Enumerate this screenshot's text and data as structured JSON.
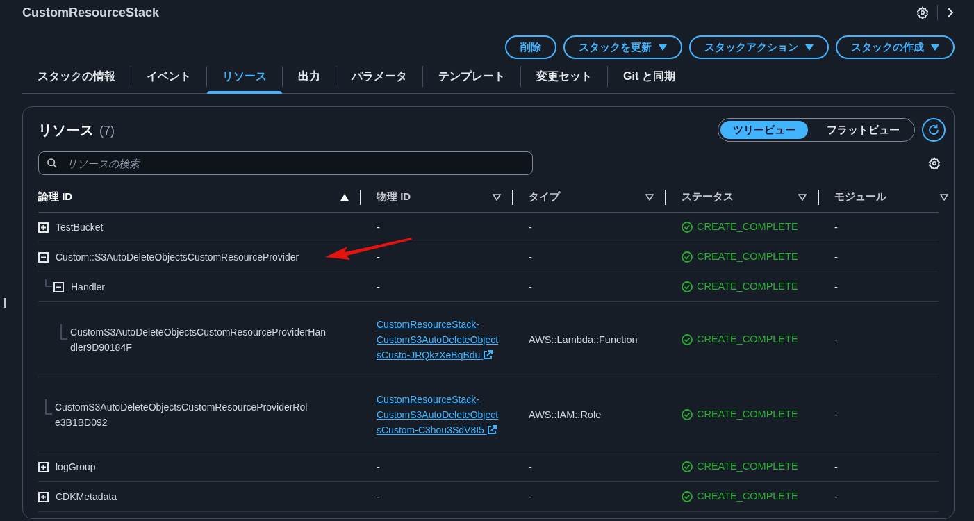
{
  "header": {
    "title": "CustomResourceStack"
  },
  "actions": [
    {
      "label": "削除",
      "dropdown": false
    },
    {
      "label": "スタックを更新",
      "dropdown": true
    },
    {
      "label": "スタックアクション",
      "dropdown": true
    },
    {
      "label": "スタックの作成",
      "dropdown": true
    }
  ],
  "tabs": [
    {
      "label": "スタックの情報",
      "selected": false
    },
    {
      "label": "イベント",
      "selected": false
    },
    {
      "label": "リソース",
      "selected": true
    },
    {
      "label": "出力",
      "selected": false
    },
    {
      "label": "パラメータ",
      "selected": false
    },
    {
      "label": "テンプレート",
      "selected": false
    },
    {
      "label": "変更セット",
      "selected": false
    },
    {
      "label": "Git と同期",
      "selected": false
    }
  ],
  "panel": {
    "title": "リソース",
    "count": "(7)",
    "view_toggle": [
      {
        "label": "ツリービュー",
        "selected": true
      },
      {
        "label": "フラットビュー",
        "selected": false
      }
    ],
    "search": {
      "placeholder": "リソースの検索"
    },
    "columns": [
      {
        "label": "論理 ID",
        "sorted": true
      },
      {
        "label": "物理 ID",
        "sorted": false
      },
      {
        "label": "タイプ",
        "sorted": false
      },
      {
        "label": "ステータス",
        "sorted": false
      },
      {
        "label": "モジュール",
        "sorted": false
      }
    ],
    "rows": [
      {
        "logical_id": "TestBucket",
        "expanded": false,
        "physical_id": "-",
        "type": "-",
        "status": "CREATE_COMPLETE",
        "module": "-"
      },
      {
        "logical_id": "Custom::S3AutoDeleteObjectsCustomResourceProvider",
        "expanded": true,
        "physical_id": "-",
        "type": "-",
        "status": "CREATE_COMPLETE",
        "module": "-",
        "children": [
          {
            "logical_id": "Handler",
            "expanded": true,
            "physical_id": "-",
            "type": "-",
            "status": "CREATE_COMPLETE",
            "module": "-",
            "children": [
              {
                "logical_id": "CustomS3AutoDeleteObjectsCustomResourceProviderHandler9D90184F",
                "physical_id": "CustomResourceStack-CustomS3AutoDeleteObjectsCusto-JRQkzXeBqBdu",
                "type": "AWS::Lambda::Function",
                "status": "CREATE_COMPLETE",
                "module": "-"
              }
            ]
          },
          {
            "logical_id": "CustomS3AutoDeleteObjectsCustomResourceProviderRole3B1BD092",
            "physical_id": "CustomResourceStack-CustomS3AutoDeleteObjectsCustom-C3hou3SdV8I5",
            "type": "AWS::IAM::Role",
            "status": "CREATE_COMPLETE",
            "module": "-"
          }
        ]
      },
      {
        "logical_id": "logGroup",
        "expanded": false,
        "physical_id": "-",
        "type": "-",
        "status": "CREATE_COMPLETE",
        "module": "-"
      },
      {
        "logical_id": "CDKMetadata",
        "expanded": false,
        "physical_id": "-",
        "type": "-",
        "status": "CREATE_COMPLETE",
        "module": "-"
      }
    ]
  }
}
